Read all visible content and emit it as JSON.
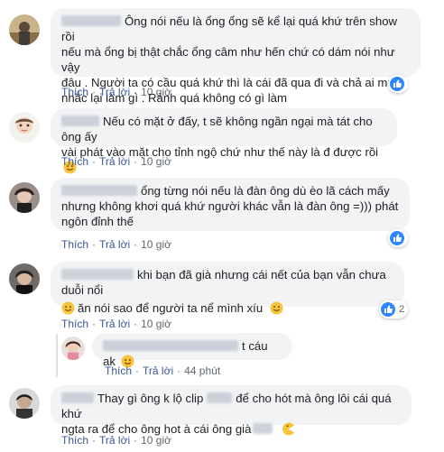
{
  "comments": [
    {
      "text": "Ông nói nếu là ổng ổng sẽ kể lại quá khứ trên show rồi nếu mà ổng bị thật chắc ổng câm như hến chứ có dám nói như vậy đâu . Người ta có cầu quá khứ thì là cái đã qua đi và chả ai muốn nhắc lại làm gì . Rảnh quá không có gì làm",
      "lines": [
        "Ông nói nếu là ổng ổng sẽ kể lại quá khứ trên show rồi",
        "nếu mà ổng bị thật chắc ổng câm như hến chứ có dám nói như vậy",
        "đâu . Người ta có cầu quá khứ thì là cái đã qua đi và chả ai muốn",
        "nhắc lại làm gì . Rảnh quá không có gì làm"
      ],
      "like": "Thích",
      "reply": "Trả lời",
      "time": "10 giờ"
    },
    {
      "lines": [
        "Nếu có mặt ở đấy, t sẽ không ngần ngại mà tát cho ông ấy",
        "vài phát vào mặt cho tỉnh ngộ chứ như thế này là đ được rồi"
      ],
      "like": "Thích",
      "reply": "Trả lời",
      "time": "10 giờ"
    },
    {
      "lines": [
        "ổng từng nói nếu là đàn ông dù èo lã cách mấy",
        "nhưng không khơi quá khứ người khác vẫn là đàn ông =))) phát",
        "ngôn đỉnh thế"
      ],
      "like": "Thích",
      "reply": "Trả lời",
      "time": "10 giờ"
    },
    {
      "lines": [
        "khi bạn đã già nhưng cái nết của bạn vẫn chưa duỗi nổi",
        "ăn nói sao để người ta nể mình xíu"
      ],
      "like": "Thích",
      "reply": "Trả lời",
      "time": "10 giờ",
      "react_count": "2"
    },
    {
      "lines": [
        "t cáu ak"
      ],
      "like": "Thích",
      "reply": "Trả lời",
      "time": "44 phút"
    },
    {
      "lines": [
        "Thay gì ông k lộ clip",
        "để cho hót mà ông lôi cái quá khứ",
        "ngta ra để cho ông hot à cái ông già"
      ],
      "like": "Thích",
      "reply": "Trả lời",
      "time": "10 giờ"
    }
  ],
  "colors": {
    "bubble": "#f2f3f5",
    "link": "#385898",
    "like_blue": "#2d88ff",
    "meta": "#606770"
  }
}
